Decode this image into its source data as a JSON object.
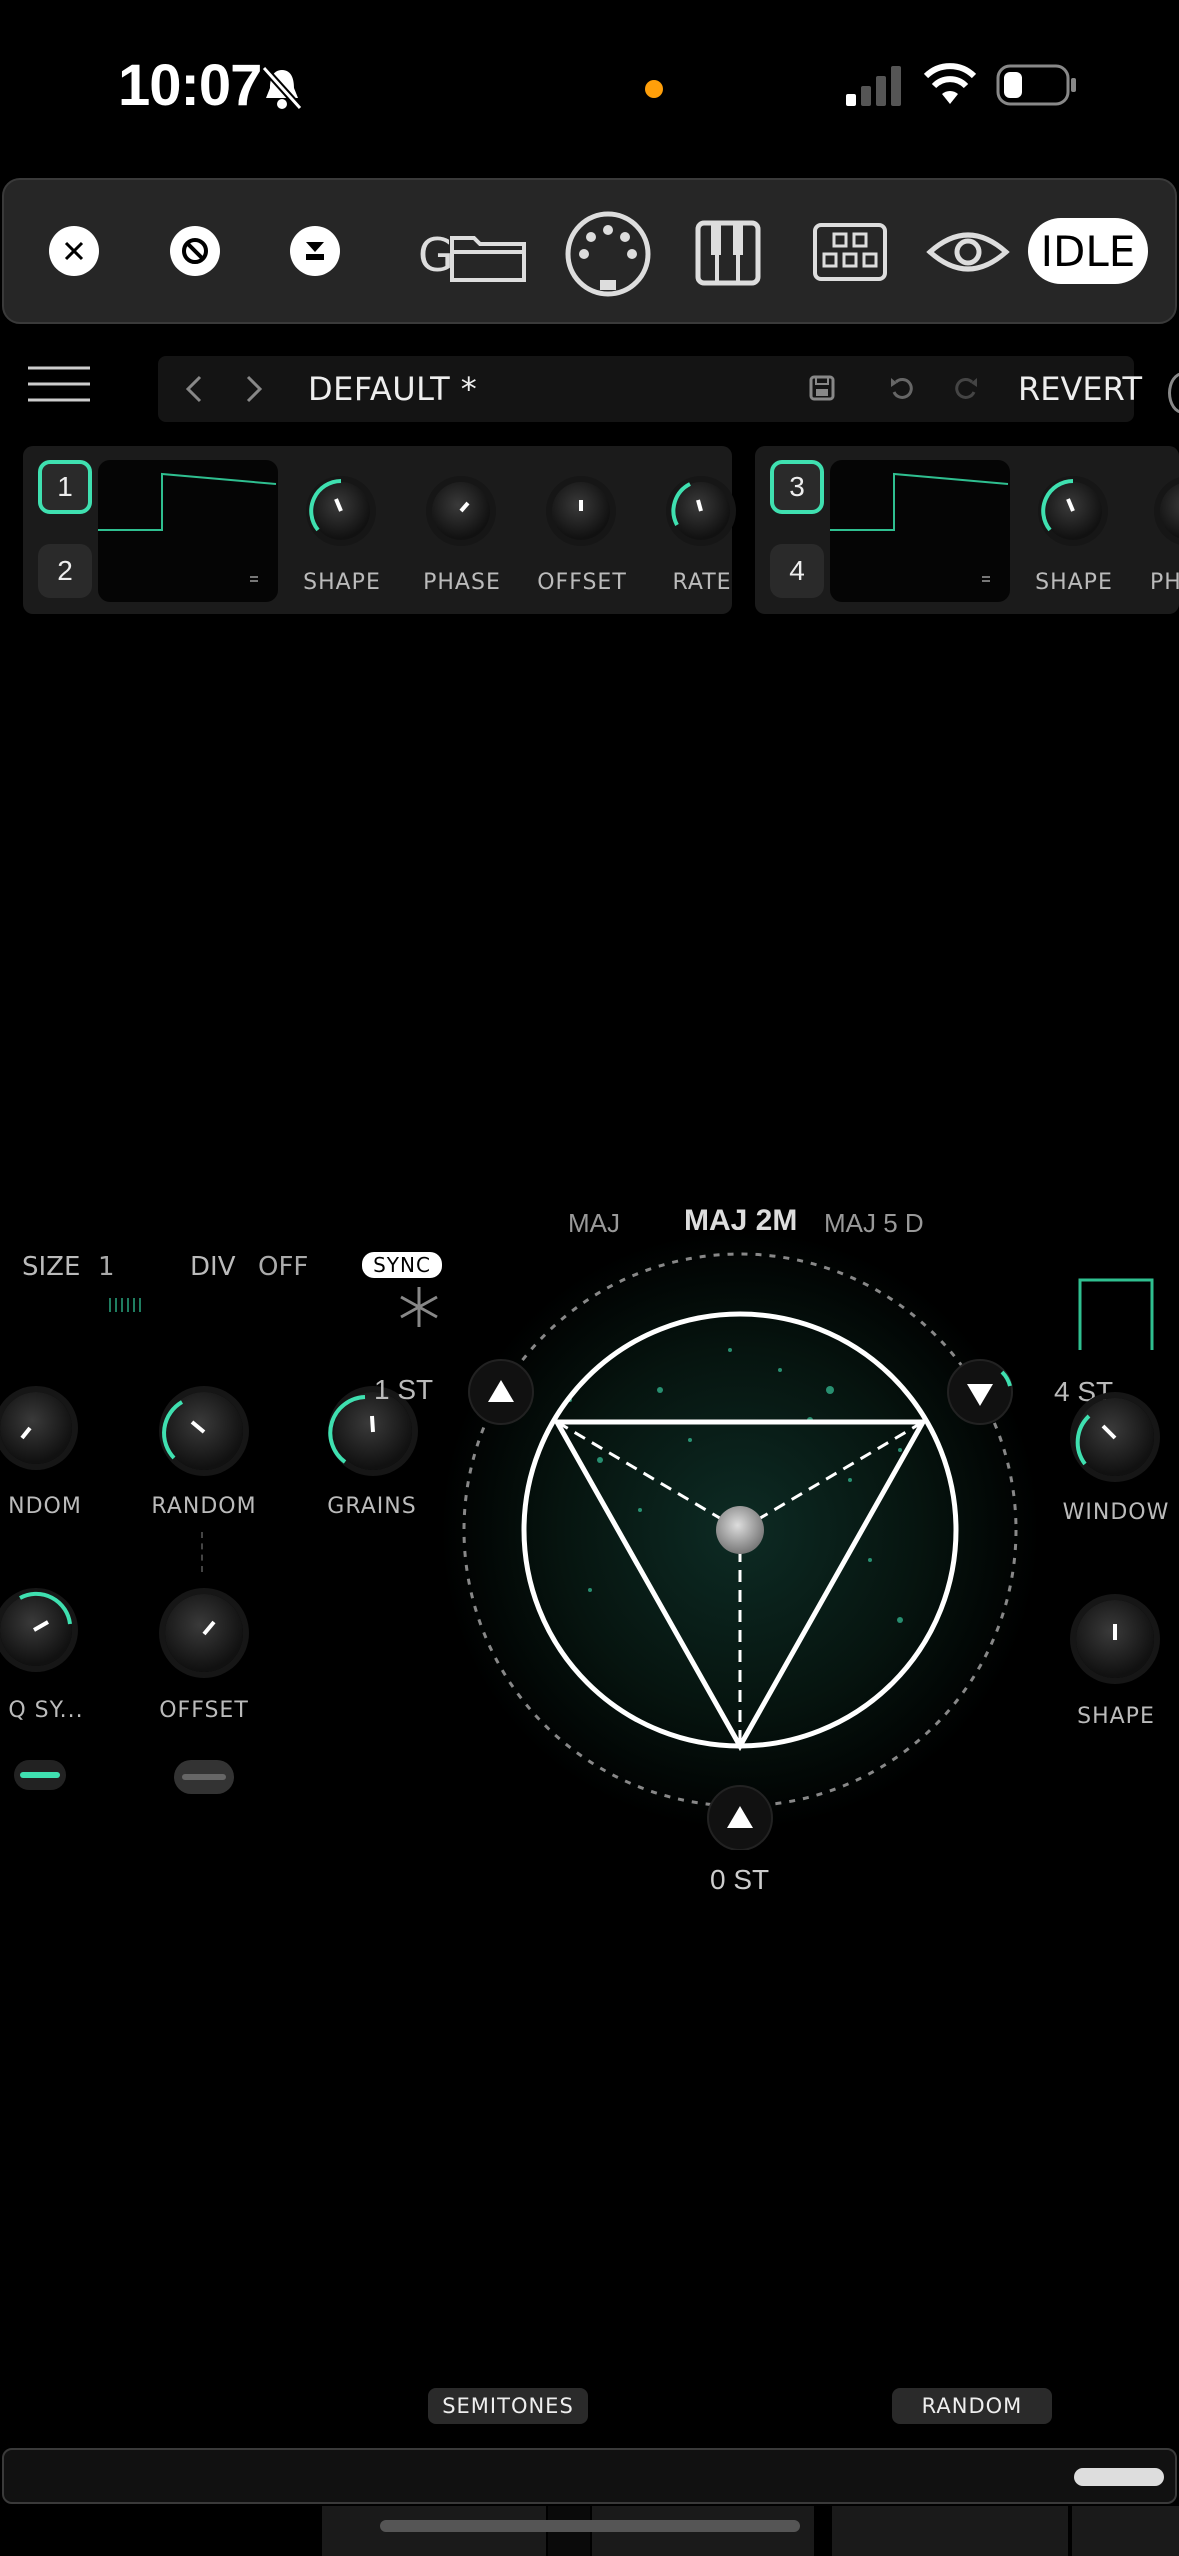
{
  "status": {
    "time": "10:07"
  },
  "toolbar": {
    "idle_label": "IDLE",
    "folder_letter": "G"
  },
  "preset": {
    "name": "DEFAULT *",
    "revert_label": "REVERT"
  },
  "lfo": {
    "panel1": {
      "buttons": [
        "1",
        "2"
      ],
      "labels": [
        "SHAPE",
        "PHASE",
        "OFFSET",
        "RATE"
      ]
    },
    "panel2": {
      "buttons": [
        "3",
        "4"
      ],
      "labels": [
        "SHAPE",
        "PH"
      ]
    }
  },
  "granular": {
    "size_label": "SIZE",
    "size_value": "1",
    "div_label": "DIV",
    "div_value": "OFF",
    "sync_label": "SYNC",
    "knobs": [
      "NDOM",
      "RANDOM",
      "GRAINS",
      "Q SY...",
      "OFFSET",
      "WINDOW",
      "SHAPE"
    ],
    "grains_value": "1 ST",
    "right_value": "4 ST"
  },
  "chord": {
    "prev": "MAJ",
    "current": "MAJ 2M",
    "next": "MAJ 5 D",
    "bottom_value": "0 ST"
  },
  "bottom": {
    "semitones_label": "SEMITONES",
    "random_label": "RANDOM"
  },
  "colors": {
    "accent": "#3fe0b0",
    "background": "#000000",
    "panel": "#1b1b1b"
  }
}
